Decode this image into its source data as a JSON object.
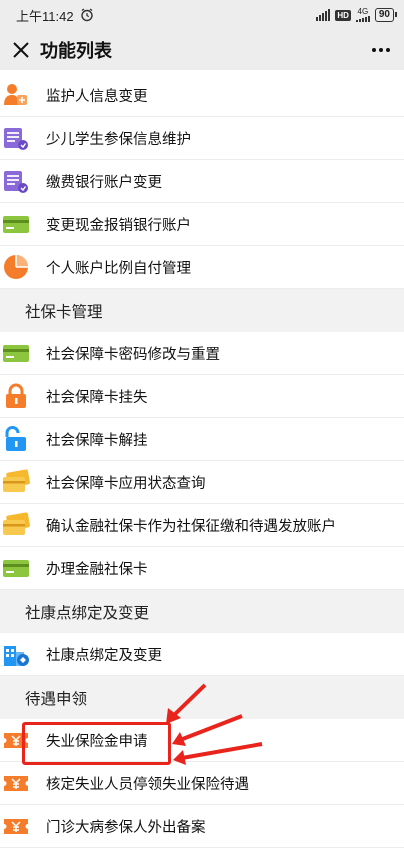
{
  "status_bar": {
    "time": "上午11:42",
    "network": "4G",
    "battery": "90"
  },
  "title_bar": {
    "title": "功能列表"
  },
  "top_items": [
    {
      "label": "监护人信息变更",
      "icon": "guardian-icon"
    },
    {
      "label": "少儿学生参保信息维护",
      "icon": "document-list-icon"
    },
    {
      "label": "缴费银行账户变更",
      "icon": "document-list-icon"
    },
    {
      "label": "变更现金报销银行账户",
      "icon": "bank-card-icon"
    },
    {
      "label": "个人账户比例自付管理",
      "icon": "pie-chart-icon"
    }
  ],
  "sections": [
    {
      "title": "社保卡管理",
      "items": [
        {
          "label": "社会保障卡密码修改与重置",
          "icon": "card-icon"
        },
        {
          "label": "社会保障卡挂失",
          "icon": "lock-icon"
        },
        {
          "label": "社会保障卡解挂",
          "icon": "unlock-icon"
        },
        {
          "label": "社会保障卡应用状态查询",
          "icon": "cards-icon"
        },
        {
          "label": "确认金融社保卡作为社保征缴和待遇发放账户",
          "icon": "cards-icon"
        },
        {
          "label": "办理金融社保卡",
          "icon": "card-icon"
        }
      ]
    },
    {
      "title": "社康点绑定及变更",
      "items": [
        {
          "label": "社康点绑定及变更",
          "icon": "clinic-icon"
        }
      ]
    },
    {
      "title": "待遇申领",
      "items": [
        {
          "label": "失业保险金申请",
          "icon": "voucher-icon"
        },
        {
          "label": "核定失业人员停领失业保险待遇",
          "icon": "voucher-icon"
        },
        {
          "label": "门诊大病参保人外出备案",
          "icon": "voucher-icon"
        }
      ]
    }
  ],
  "colors": {
    "accent_red": "#e8241c",
    "orange": "#f57c2a",
    "purple": "#8a6ad8",
    "green": "#8cc63f",
    "yellow": "#f5b82e",
    "blue": "#2196f3"
  }
}
